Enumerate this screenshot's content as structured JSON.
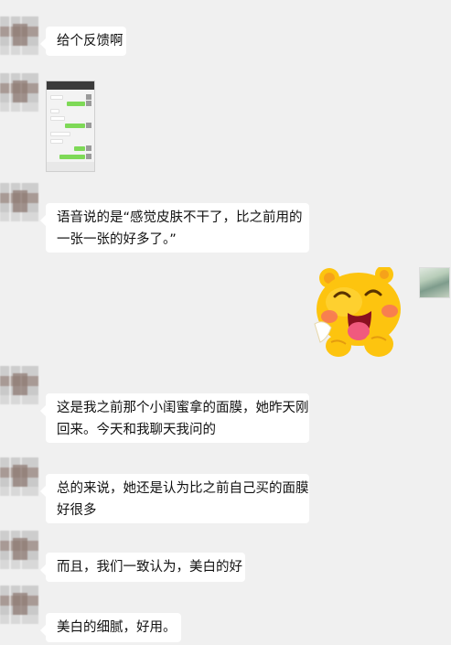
{
  "chat": {
    "messages": [
      {
        "sender": "contact",
        "type": "text",
        "lines": [
          "给个反馈啊"
        ]
      },
      {
        "sender": "contact",
        "type": "image",
        "icon": "screenshot-thumbnail"
      },
      {
        "sender": "contact",
        "type": "text",
        "lines": [
          "语音说的是“感觉皮肤不干了，比之前用的",
          "一张一张的好多了。”"
        ]
      },
      {
        "sender": "self",
        "type": "sticker",
        "icon": "yellow-cartoon-sticker"
      },
      {
        "sender": "contact",
        "type": "text",
        "lines": [
          "这是我之前那个小闺蜜拿的面膜，她昨天刚",
          "回来。今天和我聊天我问的"
        ]
      },
      {
        "sender": "contact",
        "type": "text",
        "lines": [
          "总的来说，她还是认为比之前自己买的面膜",
          "好很多"
        ]
      },
      {
        "sender": "contact",
        "type": "text",
        "lines": [
          "而且，我们一致认为，美白的好"
        ]
      },
      {
        "sender": "contact",
        "type": "text",
        "lines": [
          "美白的细腻，好用。"
        ]
      }
    ]
  },
  "colors": {
    "background": "#f0f0f0",
    "bubble": "#ffffff",
    "sticker": "#fdc40f",
    "tongue": "#f05a7e"
  }
}
